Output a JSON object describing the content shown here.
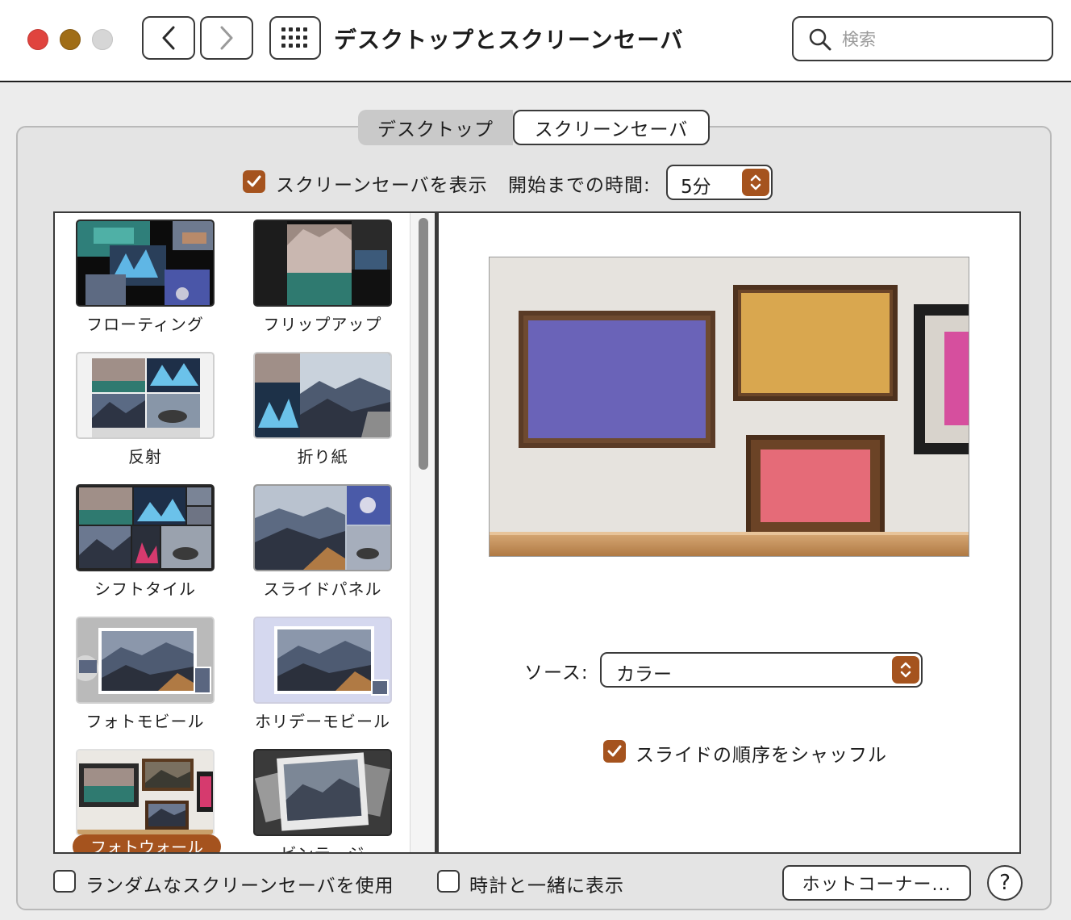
{
  "window": {
    "title": "デスクトップとスクリーンセーバ"
  },
  "search": {
    "placeholder": "検索"
  },
  "tabs": [
    {
      "label": "デスクトップ"
    },
    {
      "label": "スクリーンセーバ"
    }
  ],
  "controls": {
    "show_screensaver_label": "スクリーンセーバを表示",
    "show_screensaver_checked": true,
    "start_time_label": "開始までの時間:",
    "start_time_value": "5分",
    "source_label": "ソース:",
    "source_value": "カラー",
    "shuffle_label": "スライドの順序をシャッフル",
    "shuffle_checked": true,
    "random_label": "ランダムなスクリーンセーバを使用",
    "random_checked": false,
    "clock_label": "時計と一緒に表示",
    "clock_checked": false,
    "hot_corners_label": "ホットコーナー...",
    "help_label": "?"
  },
  "screensavers": [
    {
      "label": "フローティング"
    },
    {
      "label": "フリップアップ"
    },
    {
      "label": "反射"
    },
    {
      "label": "折り紙"
    },
    {
      "label": "シフトタイル"
    },
    {
      "label": "スライドパネル"
    },
    {
      "label": "フォトモビール"
    },
    {
      "label": "ホリデーモビール"
    },
    {
      "label": "フォトウォール",
      "selected": true
    },
    {
      "label": "ビンテージ"
    }
  ],
  "preview_colors": {
    "frame1": "#6a63b8",
    "frame2": "#d9a74f",
    "frame3": "#e56b78",
    "frame4": "#d64f9e"
  },
  "accent": "#a5531e"
}
